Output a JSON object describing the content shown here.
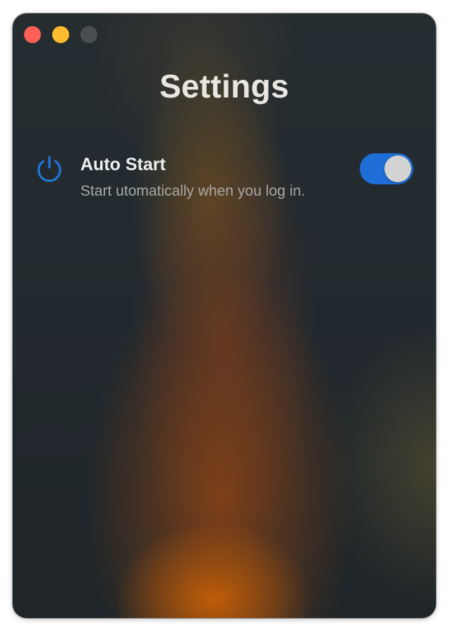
{
  "window": {
    "controls": {
      "close_color": "#fe5f57",
      "minimize_color": "#febc2e",
      "zoom_color": "#4a4e51"
    }
  },
  "title": "Settings",
  "settings": [
    {
      "icon": "power-icon",
      "label": "Auto Start",
      "description": "Start utomatically when you log in.",
      "enabled": true
    }
  ],
  "colors": {
    "accent": "#1f6ed8",
    "icon": "#1f7ce4"
  }
}
